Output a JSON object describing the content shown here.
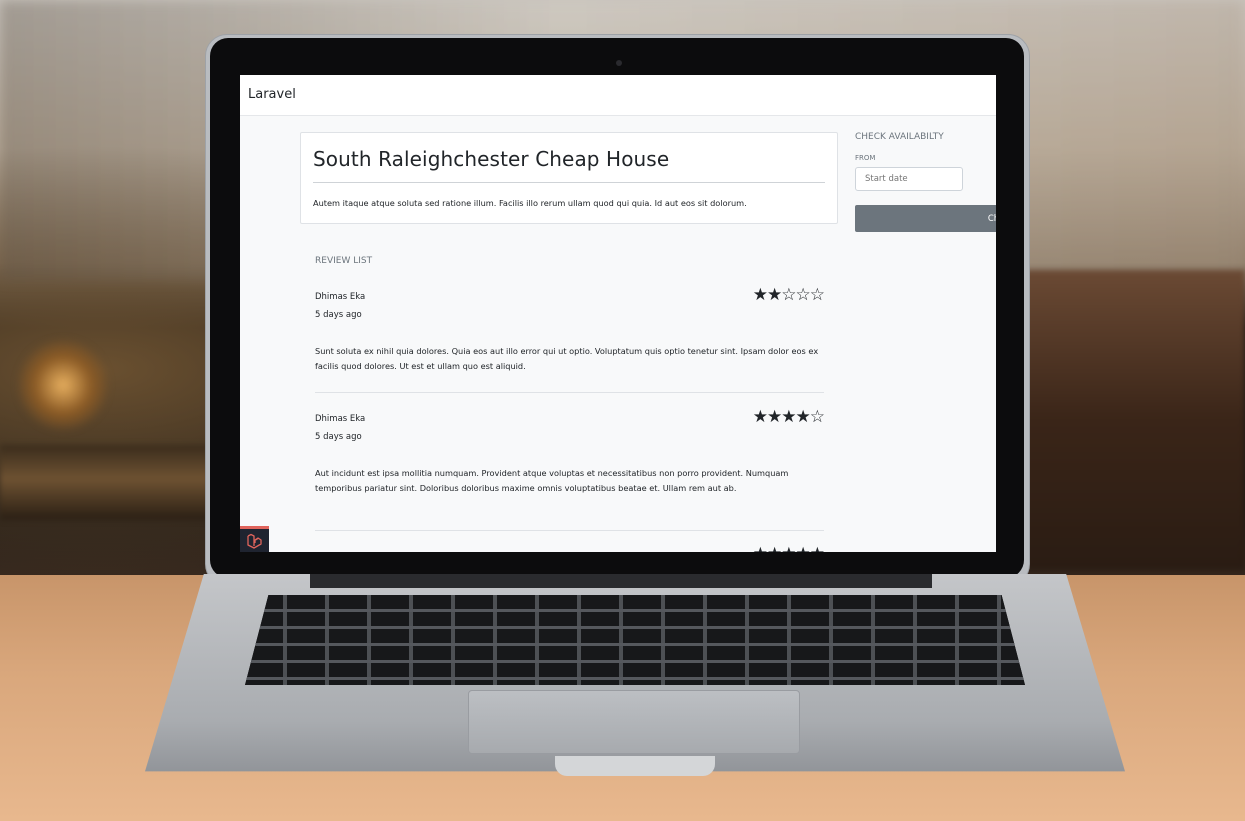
{
  "app": {
    "brand": "Laravel"
  },
  "house": {
    "title": "South Raleighchester Cheap House",
    "description": "Autem itaque atque soluta sed ratione illum. Facilis illo rerum ullam quod qui quia. Id aut eos sit dolorum."
  },
  "availability": {
    "title": "CHECK AVAILABILTY",
    "from_label": "FROM",
    "from_placeholder": "Start date",
    "check_button_label": "Check"
  },
  "reviews": {
    "title": "REVIEW LIST",
    "items": [
      {
        "name": "Dhimas Eka",
        "time": "5 days ago",
        "rating": 2,
        "stars": "★★☆☆☆",
        "body": "Sunt soluta ex nihil quia dolores. Quia eos aut illo error qui ut optio. Voluptatum quis optio tenetur sint. Ipsam dolor eos ex facilis quod dolores. Ut est et ullam quo est aliquid."
      },
      {
        "name": "Dhimas Eka",
        "time": "5 days ago",
        "rating": 4,
        "stars": "★★★★☆",
        "body": "Aut incidunt est ipsa mollitia numquam. Provident atque voluptas et necessitatibus non porro provident. Numquam temporibus pariatur sint. Doloribus doloribus maxime omnis voluptatibus beatae et. Ullam rem aut ab."
      },
      {
        "stars": "★★★★★"
      }
    ]
  },
  "icons": {
    "star_filled": "star-icon",
    "star_empty": "star-outline-icon",
    "laravel_badge": "laravel-logo-icon"
  },
  "colors": {
    "button_bg": "#6c757d",
    "badge_accent": "#e0645c",
    "badge_bg": "#1f2430"
  }
}
